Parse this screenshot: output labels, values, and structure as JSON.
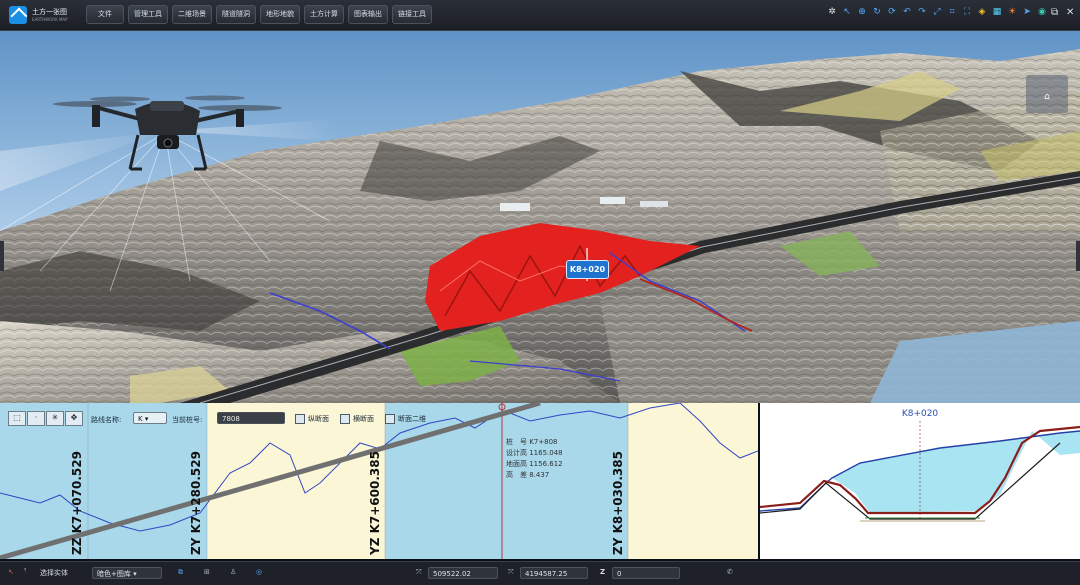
{
  "app": {
    "title": "土方一张图",
    "subtitle": "EARTHWORK MAP"
  },
  "menu": [
    "文件",
    "管理工具",
    "二维场景",
    "隧道隧洞",
    "地形地貌",
    "土方计算",
    "图表输出",
    "链接工具"
  ],
  "toolbar_icons": [
    "gear-icon",
    "select-icon",
    "zoom-icon",
    "rotate-icon",
    "refresh-icon",
    "undo-icon",
    "redo-icon",
    "measure-icon",
    "crop-icon",
    "fullscreen-icon",
    "layers-icon",
    "flag-icon",
    "sun-icon",
    "pin-icon",
    "globe-icon"
  ],
  "window_controls": {
    "restore": "⧉",
    "close": "✕"
  },
  "scene": {
    "station_label": "K8+020"
  },
  "profile": {
    "route_label": "路线名称:",
    "route_value": "K",
    "station_label": "当前桩号:",
    "station_value": "7808",
    "check1": "纵断面",
    "check2": "横断面",
    "check3": "断面二维",
    "stations": [
      "ZZ K7+070.529",
      "ZY K7+280.529",
      "YZ K7+600.385",
      "ZY K8+030.385"
    ],
    "info_lines": [
      "桩　号  K7+808",
      "设计高  1165.048",
      "地面高  1156.612",
      "高　差  8.437"
    ]
  },
  "section": {
    "title": "K8+020"
  },
  "status": {
    "mode_label": "选择实体",
    "filter_value": "暗色+图库",
    "x_value": "509522.02",
    "y_value": "4194587.25",
    "z_label": "Z",
    "z_value": "0"
  },
  "colors": {
    "accent": "#1e73cf",
    "cut_fill": "#e3221f",
    "profile_bg": "#a8d8ea",
    "profile_highlight": "#fbf7d6"
  }
}
